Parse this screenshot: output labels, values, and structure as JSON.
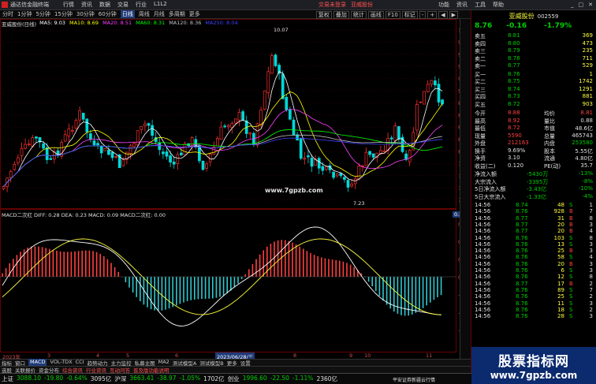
{
  "app": {
    "title": "通达信金融终端",
    "menus": [
      "行情",
      "资讯",
      "数据",
      "交易",
      "行业",
      "L1L2"
    ],
    "right_buttons": [
      "功能",
      "资讯",
      "工具",
      "帮助"
    ],
    "trade_tabs": [
      "交易未登录",
      "亚威股份"
    ]
  },
  "toolbar": {
    "periods": [
      "分时",
      "1分钟",
      "5分钟",
      "15分钟",
      "30分钟",
      "60分钟",
      "日线",
      "周线",
      "月线",
      "多周期",
      "更多"
    ],
    "active_period": "日线",
    "right": [
      "复权",
      "叠加",
      "统计",
      "画线",
      "F10",
      "标记",
      "-",
      "+",
      "◀",
      "▶"
    ]
  },
  "main_chart": {
    "stock_line": "亚威股份(日线)",
    "ma_legend": [
      {
        "text": "MA5: 9.03",
        "color": "#ffffff"
      },
      {
        "text": "MA10: 8.69",
        "color": "#ffff00"
      },
      {
        "text": "MA20: 8.51",
        "color": "#ff40ff"
      },
      {
        "text": "MA60: 8.31",
        "color": "#00ff00"
      },
      {
        "text": "MA120: 8.36",
        "color": "#c0c0c0"
      },
      {
        "text": "MA250: 8.04",
        "color": "#4040ff"
      }
    ],
    "price_ticks": [
      "10.00",
      "9.80",
      "9.60",
      "9.40",
      "9.20",
      "9.00",
      "8.80",
      "8.60",
      "8.40",
      "8.20",
      "8.00",
      "7.80",
      "7.60",
      "7.40",
      "7.20"
    ],
    "high_label": "10.07",
    "low_label": "7.23",
    "site_watermark": "www.7gpzb.com"
  },
  "macd": {
    "legend": "MACD二次红  DIFF: 0.28  DEA: 0.23  MACD: 0.09  MACD二次红: 0.00",
    "ticks": [
      "0.30",
      "0.20",
      "0.10",
      "0.00",
      "-0.10",
      "-0.20",
      "-0.30"
    ],
    "current": "0.22"
  },
  "dates": {
    "left": "2023年",
    "marks": [
      "3",
      "4",
      "5",
      "6",
      "7",
      "8",
      "9",
      "10",
      "11"
    ],
    "highlight": "2023/06/28/三"
  },
  "bottom_tabs": [
    "指标",
    "窗口",
    "MACD",
    "VOL-TDX",
    "CCI",
    "趋势动力",
    "主力监控",
    "私募主图",
    "MA2",
    "测试模型A",
    "测试模型B",
    "更多",
    "设置"
  ],
  "bottom_tabs2": [
    "选股",
    "关联报价",
    "资金分布",
    "综合资讯",
    "行业资讯",
    "互动问答",
    "普及版功能说明"
  ],
  "quote": {
    "name": "亚威股份",
    "code": "002559",
    "price": "8.76",
    "change": "-0.16",
    "pct": "-1.79%",
    "asks": [
      {
        "label": "卖五",
        "price": "8.81",
        "vol": "369"
      },
      {
        "label": "卖四",
        "price": "8.80",
        "vol": "473"
      },
      {
        "label": "卖三",
        "price": "8.79",
        "vol": "235"
      },
      {
        "label": "卖二",
        "price": "8.78",
        "vol": "711"
      },
      {
        "label": "卖一",
        "price": "8.77",
        "vol": "529"
      }
    ],
    "bids": [
      {
        "label": "买一",
        "price": "8.76",
        "vol": "1"
      },
      {
        "label": "买二",
        "price": "8.75",
        "vol": "1742"
      },
      {
        "label": "买三",
        "price": "8.74",
        "vol": "1291"
      },
      {
        "label": "买四",
        "price": "8.73",
        "vol": "881"
      },
      {
        "label": "买五",
        "price": "8.72",
        "vol": "903"
      }
    ],
    "stats": [
      {
        "l1": "今开",
        "v1": "8.88",
        "l2": "均价",
        "v2": "8.81"
      },
      {
        "l1": "最高",
        "v1": "8.92",
        "l2": "量比",
        "v2": "0.88"
      },
      {
        "l1": "最低",
        "v1": "8.72",
        "l2": "市值",
        "v2": "48.6亿"
      },
      {
        "l1": "现量",
        "v1": "5590",
        "l2": "总量",
        "v2": "465743"
      },
      {
        "l1": "外盘",
        "v1": "212163",
        "l2": "内盘",
        "v2": "253580"
      },
      {
        "l1": "换手",
        "v1": "9.69%",
        "l2": "股本",
        "v2": "5.55亿"
      },
      {
        "l1": "净资",
        "v1": "3.10",
        "l2": "流通",
        "v2": "4.80亿"
      },
      {
        "l1": "收益(二)",
        "v1": "0.120",
        "l2": "PE(动)",
        "v2": "35.7"
      }
    ],
    "flows": [
      {
        "label": "净流入额",
        "val": "-5430万",
        "pct": "-13%"
      },
      {
        "label": "大宗流入",
        "val": "-3395万",
        "pct": "-8%"
      },
      {
        "label": "5日净流入额",
        "val": "-3.43亿",
        "pct": "-10%"
      },
      {
        "label": "5日大宗流入",
        "val": "-1.33亿",
        "pct": "-4%"
      }
    ],
    "ticks": [
      [
        "14:56",
        "8.74",
        "48",
        "S",
        "1"
      ],
      [
        "14:56",
        "8.76",
        "928",
        "B",
        "7"
      ],
      [
        "14:56",
        "8.77",
        "31",
        "B",
        "8"
      ],
      [
        "14:56",
        "8.77",
        "20",
        "B",
        "3"
      ],
      [
        "14:56",
        "8.77",
        "20",
        "B",
        "4"
      ],
      [
        "14:56",
        "8.76",
        "103",
        "S",
        "8"
      ],
      [
        "14:56",
        "8.76",
        "13",
        "S",
        "3"
      ],
      [
        "14:56",
        "8.76",
        "25",
        "B",
        "3"
      ],
      [
        "14:56",
        "8.76",
        "58",
        "S",
        "4"
      ],
      [
        "14:56",
        "8.76",
        "20",
        "B",
        "3"
      ],
      [
        "14:56",
        "8.76",
        "6",
        "S",
        "3"
      ],
      [
        "14:56",
        "8.76",
        "12",
        "S",
        "8"
      ],
      [
        "14:56",
        "8.77",
        "17",
        "B",
        "2"
      ],
      [
        "14:56",
        "8.76",
        "89",
        "S",
        "7"
      ],
      [
        "14:56",
        "8.76",
        "25",
        "S",
        "2"
      ],
      [
        "14:56",
        "8.76",
        "11",
        "S",
        "3"
      ],
      [
        "14:56",
        "8.76",
        "18",
        "S",
        "2"
      ],
      [
        "14:56",
        "8.76",
        "28",
        "S",
        "3"
      ]
    ]
  },
  "status": {
    "items": [
      {
        "text": "上证",
        "cls": "white"
      },
      {
        "text": "3088.10",
        "cls": "green"
      },
      {
        "text": "-19.80",
        "cls": "green"
      },
      {
        "text": "-0.64%",
        "cls": "green"
      },
      {
        "text": "3095亿",
        "cls": "white"
      },
      {
        "text": "沪深",
        "cls": "white"
      },
      {
        "text": "3663.41",
        "cls": "green"
      },
      {
        "text": "-38.97",
        "cls": "green"
      },
      {
        "text": "-1.05%",
        "cls": "green"
      },
      {
        "text": "1702亿",
        "cls": "white"
      },
      {
        "text": "创业",
        "cls": "white"
      },
      {
        "text": "1996.60",
        "cls": "green"
      },
      {
        "text": "-22.50",
        "cls": "green"
      },
      {
        "text": "-1.11%",
        "cls": "green"
      },
      {
        "text": "2360亿",
        "cls": "white"
      }
    ],
    "right_text": "平安证券新疆云行情"
  },
  "corner": {
    "line1": "股票指标网",
    "line2": "www.7gpzb.com"
  },
  "colors": {
    "up": "#ff4040",
    "down": "#00d0d0",
    "panel_border": "#660000"
  }
}
